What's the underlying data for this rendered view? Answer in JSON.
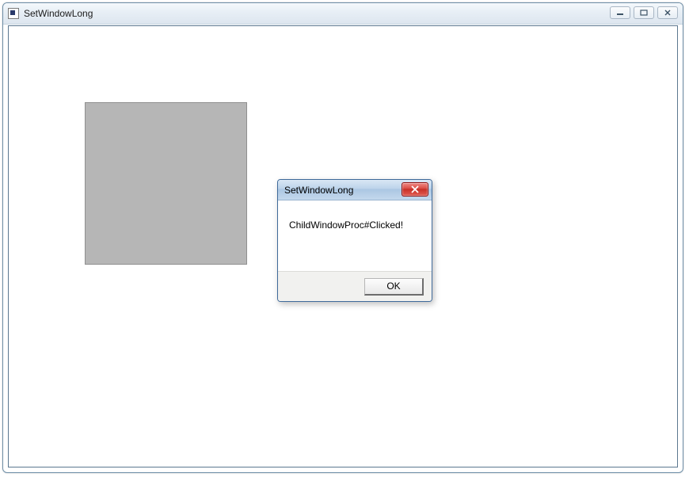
{
  "mainWindow": {
    "title": "SetWindowLong"
  },
  "dialog": {
    "title": "SetWindowLong",
    "message": "ChildWindowProc#Clicked!",
    "okLabel": "OK"
  }
}
